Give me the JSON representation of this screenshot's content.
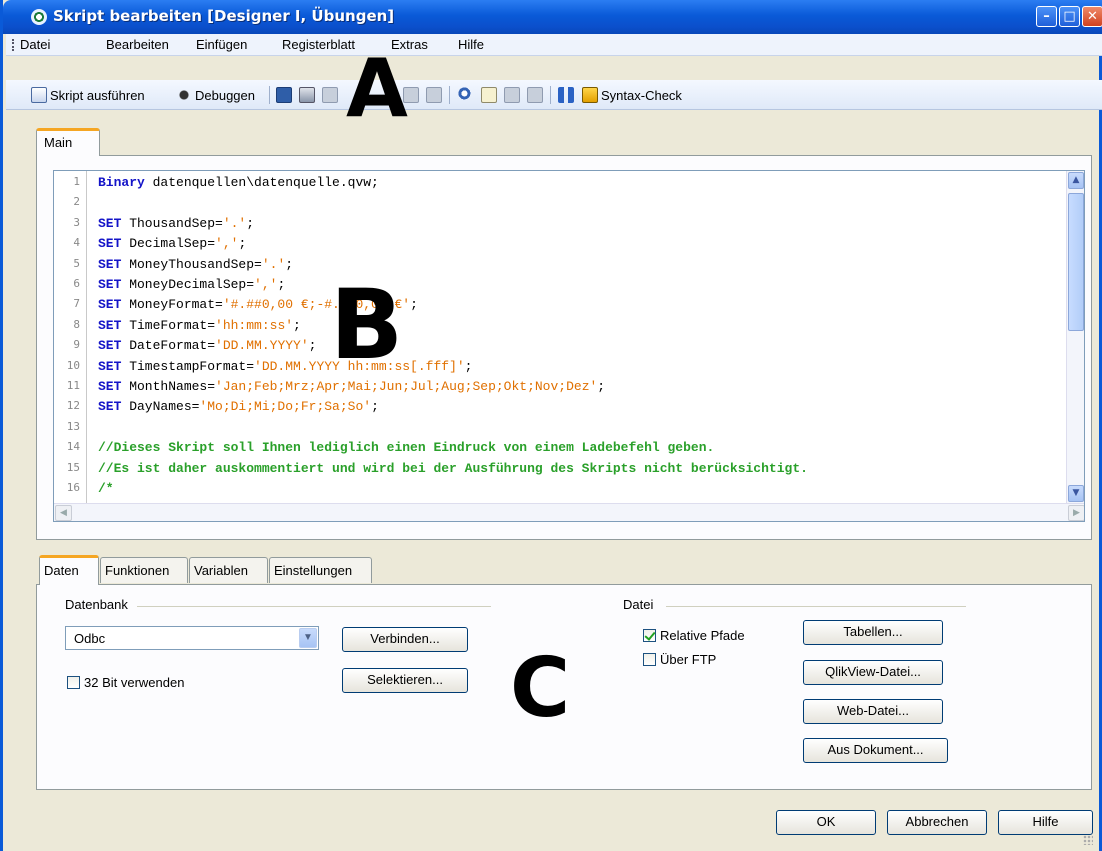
{
  "window": {
    "title": "Skript bearbeiten [Designer I, Übungen]"
  },
  "menubar": {
    "items": [
      "Datei",
      "Bearbeiten",
      "Einfügen",
      "Registerblatt",
      "Extras",
      "Hilfe"
    ]
  },
  "toolbar": {
    "run_label": "Skript ausführen",
    "debug_label": "Debuggen",
    "syntax_label": "Syntax-Check"
  },
  "overlay": {
    "a": "A",
    "b": "B",
    "c": "C"
  },
  "editor": {
    "tab_label": "Main",
    "line_numbers": [
      "1",
      "2",
      "3",
      "4",
      "5",
      "6",
      "7",
      "8",
      "9",
      "10",
      "11",
      "12",
      "13",
      "14",
      "15",
      "16"
    ],
    "lines": [
      [
        {
          "t": "kw",
          "v": "Binary"
        },
        {
          "t": "n",
          "v": " datenquellen\\datenquelle.qvw;"
        }
      ],
      [],
      [
        {
          "t": "kw",
          "v": "SET"
        },
        {
          "t": "n",
          "v": " ThousandSep="
        },
        {
          "t": "str",
          "v": "'.'"
        },
        {
          "t": "n",
          "v": ";"
        }
      ],
      [
        {
          "t": "kw",
          "v": "SET"
        },
        {
          "t": "n",
          "v": " DecimalSep="
        },
        {
          "t": "str",
          "v": "','"
        },
        {
          "t": "n",
          "v": ";"
        }
      ],
      [
        {
          "t": "kw",
          "v": "SET"
        },
        {
          "t": "n",
          "v": " MoneyThousandSep="
        },
        {
          "t": "str",
          "v": "'.'"
        },
        {
          "t": "n",
          "v": ";"
        }
      ],
      [
        {
          "t": "kw",
          "v": "SET"
        },
        {
          "t": "n",
          "v": " MoneyDecimalSep="
        },
        {
          "t": "str",
          "v": "','"
        },
        {
          "t": "n",
          "v": ";"
        }
      ],
      [
        {
          "t": "kw",
          "v": "SET"
        },
        {
          "t": "n",
          "v": " MoneyFormat="
        },
        {
          "t": "str",
          "v": "'#.##0,00 €;-#.##0,00 €'"
        },
        {
          "t": "n",
          "v": ";"
        }
      ],
      [
        {
          "t": "kw",
          "v": "SET"
        },
        {
          "t": "n",
          "v": " TimeFormat="
        },
        {
          "t": "str",
          "v": "'hh:mm:ss'"
        },
        {
          "t": "n",
          "v": ";"
        }
      ],
      [
        {
          "t": "kw",
          "v": "SET"
        },
        {
          "t": "n",
          "v": " DateFormat="
        },
        {
          "t": "str",
          "v": "'DD.MM.YYYY'"
        },
        {
          "t": "n",
          "v": ";"
        }
      ],
      [
        {
          "t": "kw",
          "v": "SET"
        },
        {
          "t": "n",
          "v": " TimestampFormat="
        },
        {
          "t": "str",
          "v": "'DD.MM.YYYY hh:mm:ss[.fff]'"
        },
        {
          "t": "n",
          "v": ";"
        }
      ],
      [
        {
          "t": "kw",
          "v": "SET"
        },
        {
          "t": "n",
          "v": " MonthNames="
        },
        {
          "t": "str",
          "v": "'Jan;Feb;Mrz;Apr;Mai;Jun;Jul;Aug;Sep;Okt;Nov;Dez'"
        },
        {
          "t": "n",
          "v": ";"
        }
      ],
      [
        {
          "t": "kw",
          "v": "SET"
        },
        {
          "t": "n",
          "v": " DayNames="
        },
        {
          "t": "str",
          "v": "'Mo;Di;Mi;Do;Fr;Sa;So'"
        },
        {
          "t": "n",
          "v": ";"
        }
      ],
      [],
      [
        {
          "t": "cmt",
          "v": "//Dieses Skript soll Ihnen lediglich einen Eindruck von einem Ladebefehl geben."
        }
      ],
      [
        {
          "t": "cmt",
          "v": "//Es ist daher auskommentiert und wird bei der Ausführung des Skripts nicht berücksichtigt."
        }
      ],
      [
        {
          "t": "cmt",
          "v": "/*"
        }
      ]
    ]
  },
  "bottom_tabs": [
    "Daten",
    "Funktionen",
    "Variablen",
    "Einstellungen"
  ],
  "datenbank": {
    "group_label": "Datenbank",
    "selected": "Odbc",
    "connect_label": "Verbinden...",
    "select_label": "Selektieren...",
    "bit32_label": "32 Bit verwenden",
    "bit32_checked": false
  },
  "datei": {
    "group_label": "Datei",
    "relative_label": "Relative Pfade",
    "relative_checked": true,
    "ftp_label": "Über FTP",
    "ftp_checked": false,
    "buttons": [
      "Tabellen...",
      "QlikView-Datei...",
      "Web-Datei...",
      "Aus Dokument..."
    ]
  },
  "footer": {
    "ok_label": "OK",
    "cancel_label": "Abbrechen",
    "help_label": "Hilfe"
  }
}
